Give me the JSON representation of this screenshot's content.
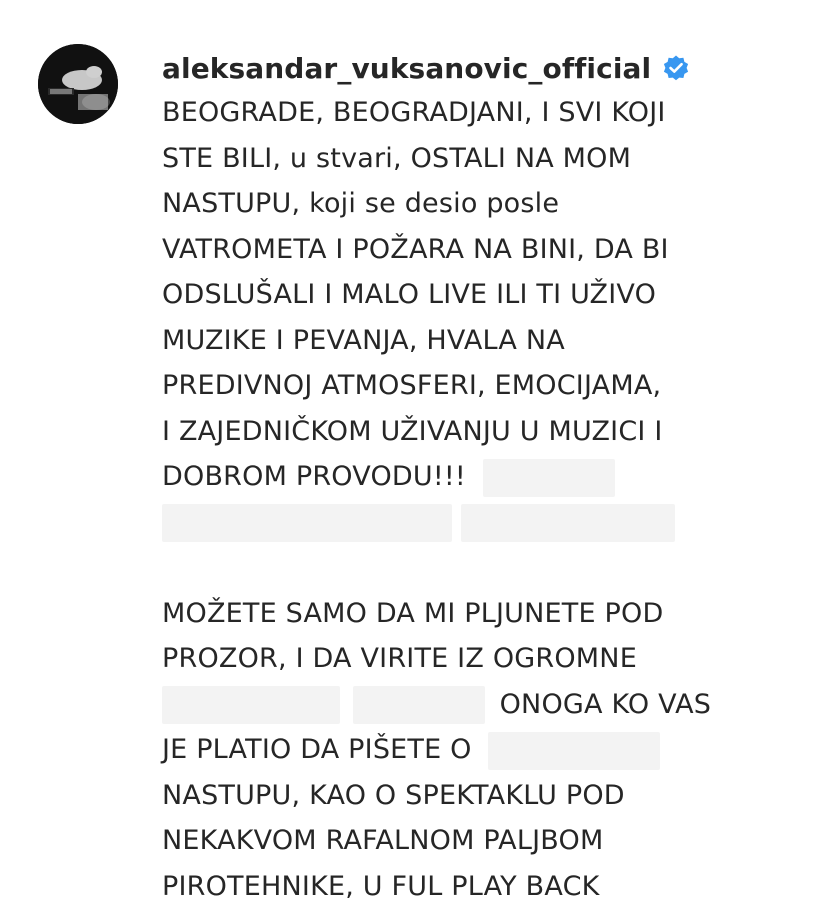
{
  "post": {
    "username": "aleksandar_vuksanovic_official",
    "verified_icon": "verified-badge-icon",
    "avatar_icon": "profile-photo",
    "accent_color": "#3897f0",
    "caption_lines": [
      "BEOGRADE, BEOGRADJANI, I SVI KOJI",
      "STE BILI, u stvari, OSTALI NA MOM",
      "NASTUPU, koji se desio posle",
      "VATROMETA I POŽARA NA BINI, DA BI",
      "ODSLUŠALI I MALO LIVE ILI TI UŽIVO",
      "MUZIKE I PEVANJA, HVALA NA",
      "PREDIVNOJ ATMOSFERI, EMOCIJAMA,",
      "I ZAJEDNIČKOM UŽIVANJU U MUZICI I",
      "DOBROM PROVODU!!!"
    ],
    "caption_lines_2": [
      "MOŽETE SAMO DA MI PLJUNETE POD",
      "PROZOR, I DA VIRITE IZ OGROMNE"
    ],
    "line_onoga": "ONOGA KO VAS",
    "line_platio": "JE PLATIO DA PIŠETE O",
    "caption_lines_3": [
      "NASTUPU, KAO O SPEKTAKLU POD",
      "NEKAKVOM RAFALNOM PALJBOM",
      "PIROTEHNIKE, U FUL PLAY BACK"
    ]
  }
}
